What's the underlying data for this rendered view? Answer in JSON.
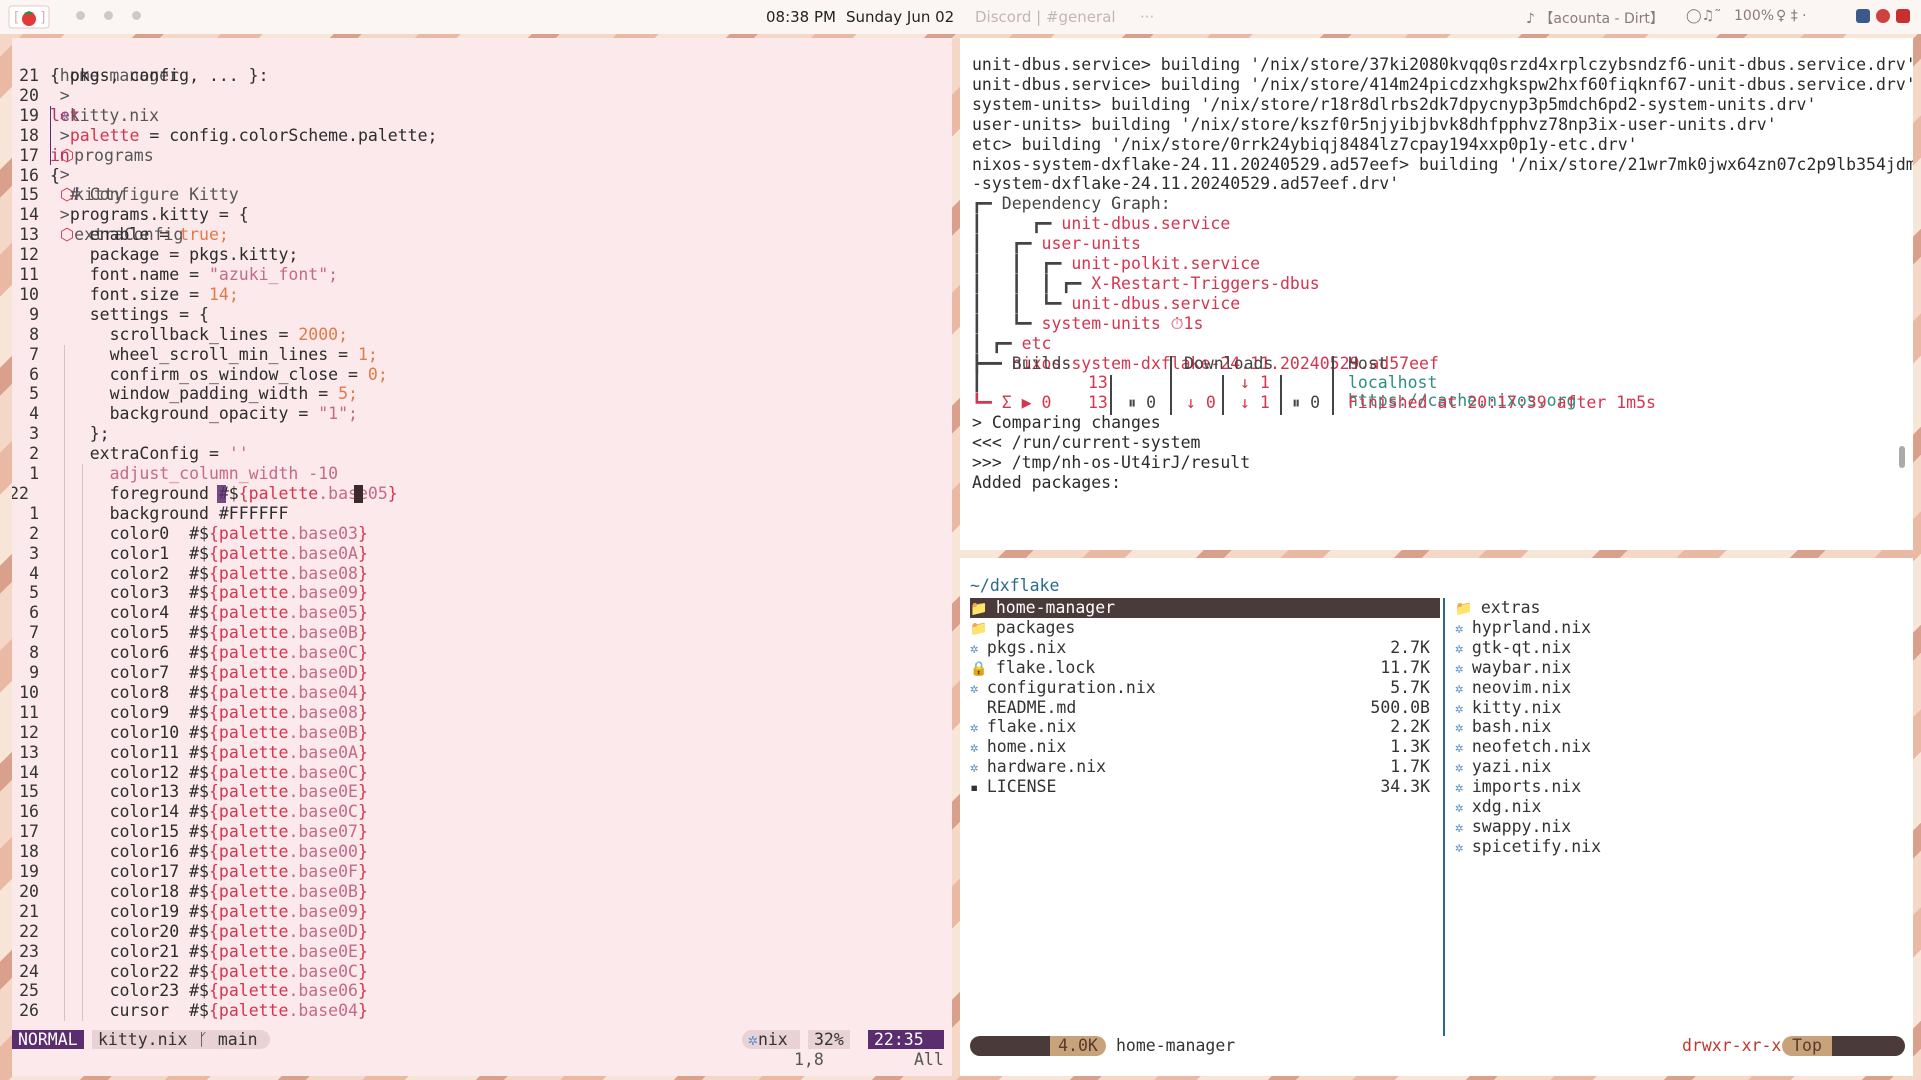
{
  "topbar": {
    "clock": "08:38 PM",
    "date": "Sunday Jun 02",
    "discord": "Discord | #general",
    "ellipsis": "···",
    "now_playing": "♪ 【acounta - Dirt】",
    "volume": "100%",
    "tray_text": "♀ ‡ ·"
  },
  "editor": {
    "breadcrumb": [
      "home-manager",
      "kitty.nix",
      "programs",
      "kitty",
      "extraConfig"
    ],
    "breadcrumb_sep": ">",
    "lines": [
      {
        "n": "21",
        "t": "{ pkgs, config, ... }:",
        "c": "plain"
      },
      {
        "n": "20",
        "t": "",
        "c": "plain"
      },
      {
        "n": "19",
        "t": "let",
        "c": "kw"
      },
      {
        "n": "18",
        "t": "  palette = config.colorScheme.palette;",
        "c": "palette"
      },
      {
        "n": "17",
        "t": "in",
        "c": "kw"
      },
      {
        "n": "16",
        "t": "{",
        "c": "plain"
      },
      {
        "n": "15",
        "t": "  # Configure Kitty",
        "c": "comment"
      },
      {
        "n": "14",
        "t": "  programs.kitty = {",
        "c": "plain"
      },
      {
        "n": "13",
        "t": "    enable = true;",
        "c": "bool"
      },
      {
        "n": "12",
        "t": "    package = pkgs.kitty;",
        "c": "plain"
      },
      {
        "n": "11",
        "t": "    font.name = \"azuki_font\";",
        "c": "string"
      },
      {
        "n": "10",
        "t": "    font.size = 14;",
        "c": "number"
      },
      {
        "n": "9",
        "t": "    settings = {",
        "c": "plain"
      },
      {
        "n": "8",
        "t": "      scrollback_lines = 2000;",
        "c": "number"
      },
      {
        "n": "7",
        "t": "      wheel_scroll_min_lines = 1;",
        "c": "number"
      },
      {
        "n": "6",
        "t": "      confirm_os_window_close = 0;",
        "c": "number"
      },
      {
        "n": "5",
        "t": "      window_padding_width = 5;",
        "c": "number"
      },
      {
        "n": "4",
        "t": "      background_opacity = \"1\";",
        "c": "string"
      },
      {
        "n": "3",
        "t": "    };",
        "c": "plain"
      },
      {
        "n": "2",
        "t": "    extraConfig = ''",
        "c": "string"
      },
      {
        "n": "1",
        "t": "      adjust_column_width -10",
        "c": "string"
      },
      {
        "n": "22",
        "t": "      foreground #${palette.base05}",
        "c": "interp"
      },
      {
        "n": "1",
        "t": "      background #FFFFFF",
        "c": "plain"
      },
      {
        "n": "2",
        "t": "      color0  #${palette.base03}",
        "c": "interp"
      },
      {
        "n": "3",
        "t": "      color1  #${palette.base0A}",
        "c": "interp"
      },
      {
        "n": "4",
        "t": "      color2  #${palette.base08}",
        "c": "interp"
      },
      {
        "n": "5",
        "t": "      color3  #${palette.base09}",
        "c": "interp"
      },
      {
        "n": "6",
        "t": "      color4  #${palette.base05}",
        "c": "interp"
      },
      {
        "n": "7",
        "t": "      color5  #${palette.base0B}",
        "c": "interp"
      },
      {
        "n": "8",
        "t": "      color6  #${palette.base0C}",
        "c": "interp"
      },
      {
        "n": "9",
        "t": "      color7  #${palette.base0D}",
        "c": "interp"
      },
      {
        "n": "10",
        "t": "      color8  #${palette.base04}",
        "c": "interp"
      },
      {
        "n": "11",
        "t": "      color9  #${palette.base08}",
        "c": "interp"
      },
      {
        "n": "12",
        "t": "      color10 #${palette.base0B}",
        "c": "interp"
      },
      {
        "n": "13",
        "t": "      color11 #${palette.base0A}",
        "c": "interp"
      },
      {
        "n": "14",
        "t": "      color12 #${palette.base0C}",
        "c": "interp"
      },
      {
        "n": "15",
        "t": "      color13 #${palette.base0E}",
        "c": "interp"
      },
      {
        "n": "16",
        "t": "      color14 #${palette.base0C}",
        "c": "interp"
      },
      {
        "n": "17",
        "t": "      color15 #${palette.base07}",
        "c": "interp"
      },
      {
        "n": "18",
        "t": "      color16 #${palette.base00}",
        "c": "interp"
      },
      {
        "n": "19",
        "t": "      color17 #${palette.base0F}",
        "c": "interp"
      },
      {
        "n": "20",
        "t": "      color18 #${palette.base0B}",
        "c": "interp"
      },
      {
        "n": "21",
        "t": "      color19 #${palette.base09}",
        "c": "interp"
      },
      {
        "n": "22",
        "t": "      color20 #${palette.base0D}",
        "c": "interp"
      },
      {
        "n": "23",
        "t": "      color21 #${palette.base0E}",
        "c": "interp"
      },
      {
        "n": "24",
        "t": "      color22 #${palette.base0C}",
        "c": "interp"
      },
      {
        "n": "25",
        "t": "      color23 #${palette.base06}",
        "c": "interp"
      },
      {
        "n": "26",
        "t": "      cursor  #${palette.base04}",
        "c": "interp"
      }
    ],
    "status": {
      "mode": "NORMAL",
      "file": "kitty.nix",
      "branch": "ᚴ main",
      "filetype": "nix",
      "percent": "32%",
      "position": "22:35",
      "ruler": "1,8",
      "all": "All"
    }
  },
  "terminal": {
    "lines": [
      "unit-dbus.service> building '/nix/store/37ki2080kvqq0srzd4xrplczybsndzf6-unit-dbus.service.drv'",
      "unit-dbus.service> building '/nix/store/414m24picdzxhgkspw2hxf60fiqknf67-unit-dbus.service.drv'",
      "system-units> building '/nix/store/r18r8dlrbs2dk7dpycnyp3p5mdch6pd2-system-units.drv'",
      "user-units> building '/nix/store/kszf0r5njyibjbvk8dhfpphvz78np3ix-user-units.drv'",
      "etc> building '/nix/store/0rrk24ybiqj8484lz7cpay194xxp0p1y-etc.drv'",
      "nixos-system-dxflake-24.11.20240529.ad57eef> building '/nix/store/21wr7mk0jwx64zn07c2p9lb354jdmr4s-nixos",
      "-system-dxflake-24.11.20240529.ad57eef.drv'"
    ],
    "graph_title": "Dependency Graph:",
    "graph": [
      {
        "label": "unit-dbus.service",
        "indent": 4
      },
      {
        "label": "user-units",
        "indent": 3
      },
      {
        "label": "unit-polkit.service",
        "indent": 4
      },
      {
        "label": "X-Restart-Triggers-dbus",
        "indent": 5
      },
      {
        "label": "unit-dbus.service",
        "indent": 4
      },
      {
        "label": "system-units ⏱1s",
        "indent": 3
      },
      {
        "label": "etc",
        "indent": 2
      },
      {
        "label": "nixos-system-dxflake-24.11.20240529.ad57eef",
        "indent": 1
      }
    ],
    "table": {
      "builds_header": "Builds",
      "downloads_header": "Downloads",
      "host_header": "Host",
      "host1": "localhost",
      "host2": "https://cache.nixos.org",
      "build_num1": "13",
      "build_num2": "13",
      "sum_line": "Σ ▶ 0",
      "pause1": "⏸ 0",
      "down0": "↓ 0",
      "down1a": "↓ 1",
      "down1b": "↓ 1",
      "pause2": "⏸ 0",
      "finished": "Finished at 20:17:39 after 1m5s"
    },
    "after": [
      "> Comparing changes",
      "<<< /run/current-system",
      ">>> /tmp/nh-os-Ut4irJ/result",
      "Added packages:"
    ]
  },
  "files": {
    "path": "~/dxflake",
    "left": [
      {
        "name": "home-manager",
        "icon": "folder",
        "size": ""
      },
      {
        "name": "packages",
        "icon": "folder",
        "size": ""
      },
      {
        "name": "pkgs.nix",
        "icon": "nix",
        "size": "2.7K"
      },
      {
        "name": "flake.lock",
        "icon": "lock",
        "size": "11.7K"
      },
      {
        "name": "configuration.nix",
        "icon": "nix",
        "size": "5.7K"
      },
      {
        "name": "README.md",
        "icon": "none",
        "size": "500.0B"
      },
      {
        "name": "flake.nix",
        "icon": "nix",
        "size": "2.2K"
      },
      {
        "name": "home.nix",
        "icon": "nix",
        "size": "1.3K"
      },
      {
        "name": "hardware.nix",
        "icon": "nix",
        "size": "1.7K"
      },
      {
        "name": "LICENSE",
        "icon": "file",
        "size": "34.3K"
      }
    ],
    "right": [
      {
        "name": "extras",
        "icon": "folder"
      },
      {
        "name": "hyprland.nix",
        "icon": "nix"
      },
      {
        "name": "gtk-qt.nix",
        "icon": "nix"
      },
      {
        "name": "waybar.nix",
        "icon": "nix"
      },
      {
        "name": "neovim.nix",
        "icon": "nix"
      },
      {
        "name": "kitty.nix",
        "icon": "nix"
      },
      {
        "name": "bash.nix",
        "icon": "nix"
      },
      {
        "name": "neofetch.nix",
        "icon": "nix"
      },
      {
        "name": "yazi.nix",
        "icon": "nix"
      },
      {
        "name": "imports.nix",
        "icon": "nix"
      },
      {
        "name": "xdg.nix",
        "icon": "nix"
      },
      {
        "name": "swappy.nix",
        "icon": "nix"
      },
      {
        "name": "spicetify.nix",
        "icon": "nix"
      }
    ],
    "status": {
      "size": "4.0K",
      "name": "home-manager",
      "perms": "drwxr-xr-x",
      "position": "Top"
    }
  },
  "colors": {
    "accent": "#5a2e6e",
    "status_dark": "#4a3a3a",
    "status_tan": "#c8a27a",
    "editor_bg": "#fbe9ec",
    "red": "#d4354f"
  }
}
